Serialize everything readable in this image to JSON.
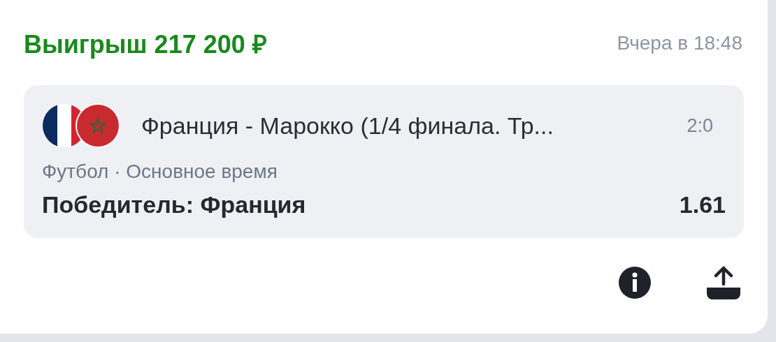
{
  "header": {
    "title": "Выигрыш 217 200 ₽",
    "time": "Вчера в 18:48"
  },
  "event": {
    "teams": "Франция - Марокко (1/4 финала. Тр...",
    "score": "2:0",
    "details": "Футбол · Основное время",
    "bet": "Победитель: Франция",
    "odds": "1.61"
  }
}
